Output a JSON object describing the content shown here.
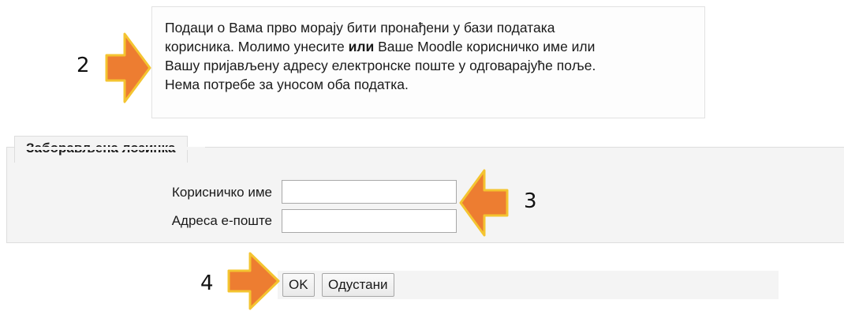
{
  "info": {
    "line1": "Подаци о Вама прво морају бити пронађени у бази података",
    "line2_before": "корисника. Молимо унесите ",
    "line2_bold": "или",
    "line2_after": " Ваше Moodle корисничко име или",
    "line3": "Вашу пријављену адресу електронске поште у одговарајуће поље.",
    "line4": "Нема потребе за уносом оба податка."
  },
  "annotations": {
    "step2": "2",
    "step3": "3",
    "step4": "4",
    "arrow_color": "#ED7D31",
    "arrow_outline": "#F4C430"
  },
  "form": {
    "legend": "Заборављена лозинка",
    "username_label": "Корисничко име",
    "username_value": "",
    "email_label": "Адреса е-поште",
    "email_value": ""
  },
  "buttons": {
    "ok": "OK",
    "cancel": "Одустани"
  }
}
